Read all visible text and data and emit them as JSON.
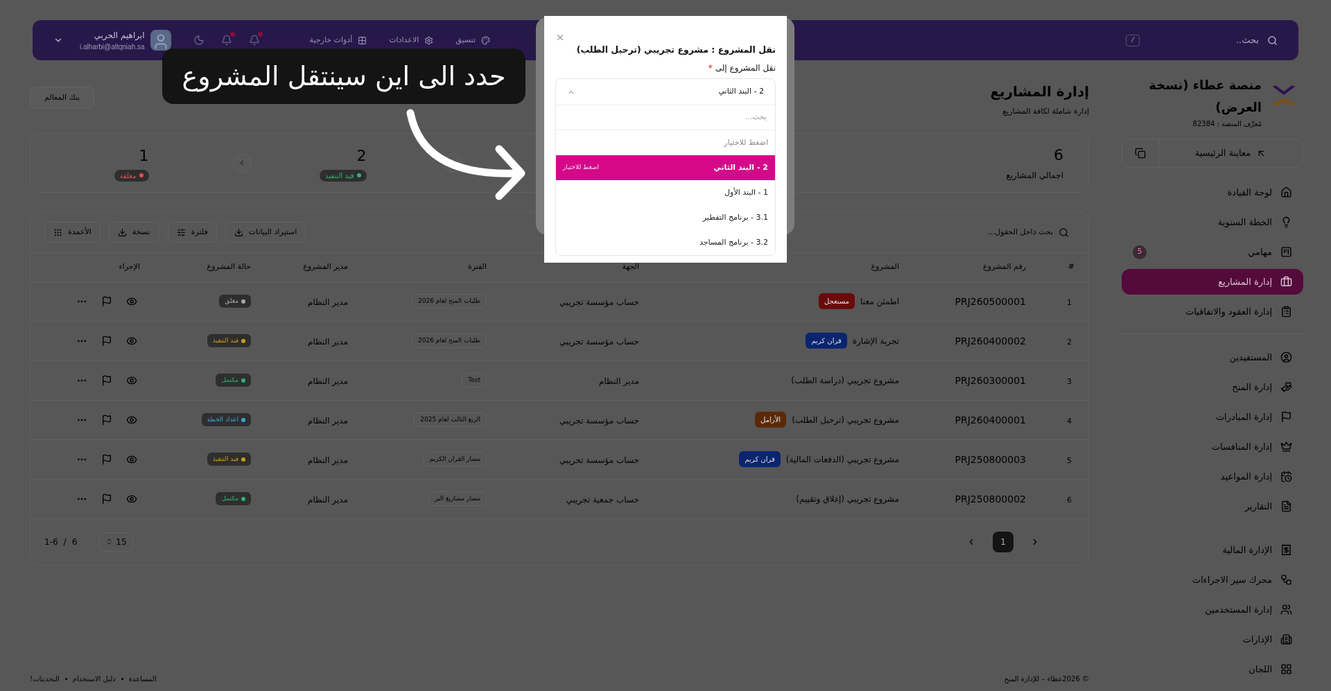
{
  "topbar": {
    "search_placeholder": "بحث..",
    "shortcut": "/",
    "links": [
      "تنسيق",
      "الاعدادات",
      "أدوات خارجية"
    ],
    "user": {
      "name": "ابراهيم الحربي",
      "email": "i.alharbi@altqniah.sa"
    }
  },
  "sidebar": {
    "brand": "منصة عطاء (نسخة العرض)",
    "platform_id": "مُعرِّف المنصة : 82384",
    "preview_button": "معاينة الرئيسية",
    "groups": [
      [
        {
          "label": "لوحة القيادة",
          "selected": false
        },
        {
          "label": "الخطة السنوية",
          "selected": false
        },
        {
          "label": "مهامي",
          "selected": false,
          "badge": "5"
        },
        {
          "label": "إدارة المشاريع",
          "selected": true
        },
        {
          "label": "إدارة العقود والاتفاقيات",
          "selected": false
        }
      ],
      [
        {
          "label": "المستفيدين",
          "selected": false
        },
        {
          "label": "إدارة المنح",
          "selected": false
        },
        {
          "label": "إدارة المبادرات",
          "selected": false
        },
        {
          "label": "إدارة المنافسات",
          "selected": false
        },
        {
          "label": "إدارة المواعيد",
          "selected": false
        },
        {
          "label": "التقارير",
          "selected": false
        }
      ],
      [
        {
          "label": "الإدارة المالية",
          "selected": false
        },
        {
          "label": "محرك سير الاجراءات",
          "selected": false
        },
        {
          "label": "إدارة المستخدمين",
          "selected": false
        },
        {
          "label": "الإدارات",
          "selected": false
        },
        {
          "label": "اللجان",
          "selected": false
        }
      ]
    ]
  },
  "header": {
    "title": "إدارة المشاريع",
    "subtitle": "إدارة شاملة لكافة المشاريع",
    "button": "بنك المعالم"
  },
  "stats": [
    {
      "value": "6",
      "label": "اجمالي المشاريع",
      "kind": "plain"
    },
    {
      "value": "2",
      "label": "قيد التنفيذ",
      "kind": "badge",
      "color": "#2fb273"
    },
    {
      "value": "1",
      "label": "مغلقة",
      "kind": "badge",
      "color": "#e05050"
    }
  ],
  "table": {
    "search_placeholder": "بحث داخل الحقول...",
    "buttons": [
      "استيراد البيانات",
      "فلترة",
      "نسخة",
      "الأعمدة"
    ],
    "columns": [
      "#",
      "رقم المشروع",
      "المشروع",
      "الجهة",
      "الفترة",
      "مدير المشروع",
      "حالة المشروع",
      "الإجراء"
    ],
    "rows": [
      {
        "index": "1",
        "number": "PRJ260500001",
        "project": "اطمئن معنا",
        "tag": {
          "label": "مستعجل",
          "color": "#6a0b0b"
        },
        "entity": "حساب مؤسسة تجريبي",
        "period": "طلبات المنح لعام 2026",
        "manager": "مدير النظام",
        "status": {
          "label": "مغلق",
          "color": "#a8a8a8"
        }
      },
      {
        "index": "2",
        "number": "PRJ260400002",
        "project": "تجربة الإشارة",
        "tag": {
          "label": "قران كريم",
          "color": "#0a2470"
        },
        "entity": "حساب مؤسسة تجريبي",
        "period": "طلبات المنح لعام 2026",
        "manager": "مدير النظام",
        "status": {
          "label": "قيد التنفيذ",
          "color": "#d49a1a"
        }
      },
      {
        "index": "3",
        "number": "PRJ260300001",
        "project": "مشروع تجريبي (دراسة الطلب)",
        "entity": "مدير النظام",
        "period": "Test",
        "manager": "مدير النظام",
        "status": {
          "label": "مكتمل",
          "color": "#2fb273"
        }
      },
      {
        "index": "4",
        "number": "PRJ260400001",
        "project": "مشروع تجريبي (ترحيل الطلب)",
        "tag": {
          "label": "الأرامل",
          "color": "#5a2a08"
        },
        "entity": "حساب مؤسسة تجريبي",
        "period": "الربع الثالث لعام 2025",
        "manager": "مدير النظام",
        "status": {
          "label": "اعداد الخطة",
          "color": "#3aa6d8"
        }
      },
      {
        "index": "5",
        "number": "PRJ250800003",
        "project": "مشروع تجريبي (الدفعات المالية)",
        "tag": {
          "label": "قران كريم",
          "color": "#0a2470"
        },
        "entity": "حساب مؤسسة تجريبي",
        "period": "مسار القران الكريم",
        "manager": "مدير النظام",
        "status": {
          "label": "قيد التنفيذ",
          "color": "#d49a1a"
        }
      },
      {
        "index": "6",
        "number": "PRJ250800002",
        "project": "مشروع تجريبي (إغلاق وتقييم)",
        "entity": "حساب جمعية تجريبي",
        "period": "مسار مشاريع البر",
        "manager": "مدير النظام",
        "status": {
          "label": "مكتمل",
          "color": "#2fb273"
        }
      }
    ],
    "pages": [
      {
        "label": "1",
        "selected": true
      }
    ],
    "per_page": "15",
    "range": "1-6",
    "separator": "/",
    "total": "6"
  },
  "footer": {
    "copyright": "© 2026عطاء – للإدارة المنح",
    "links": [
      "المساعدة",
      "دليل الاستخدام",
      "التحديثات!"
    ]
  },
  "modal": {
    "title": "نقل المشروع : مشروع تجريبي (ترحيل الطلب)",
    "field_label": "نقل المشروع إلى",
    "required_mark": "*",
    "value": "2 - البند الثاني",
    "expanded": true,
    "search_placeholder": "بحث...",
    "options": [
      {
        "label": "اضغط للاختيار",
        "kind": "placeholder",
        "selected": false
      },
      {
        "label": "2 - البند الثاني",
        "kind": "option",
        "selected": true,
        "hint": "اضغط للاختيار"
      },
      {
        "label": "1 - البند الأول",
        "kind": "option",
        "selected": false
      },
      {
        "label": "3.1 - برنامج التفطير",
        "kind": "option",
        "selected": false
      },
      {
        "label": "3.2 - برنامج المساجد",
        "kind": "option",
        "selected": false
      }
    ]
  },
  "callout": {
    "text": "حدد الى اين سينتقل المشروع"
  }
}
